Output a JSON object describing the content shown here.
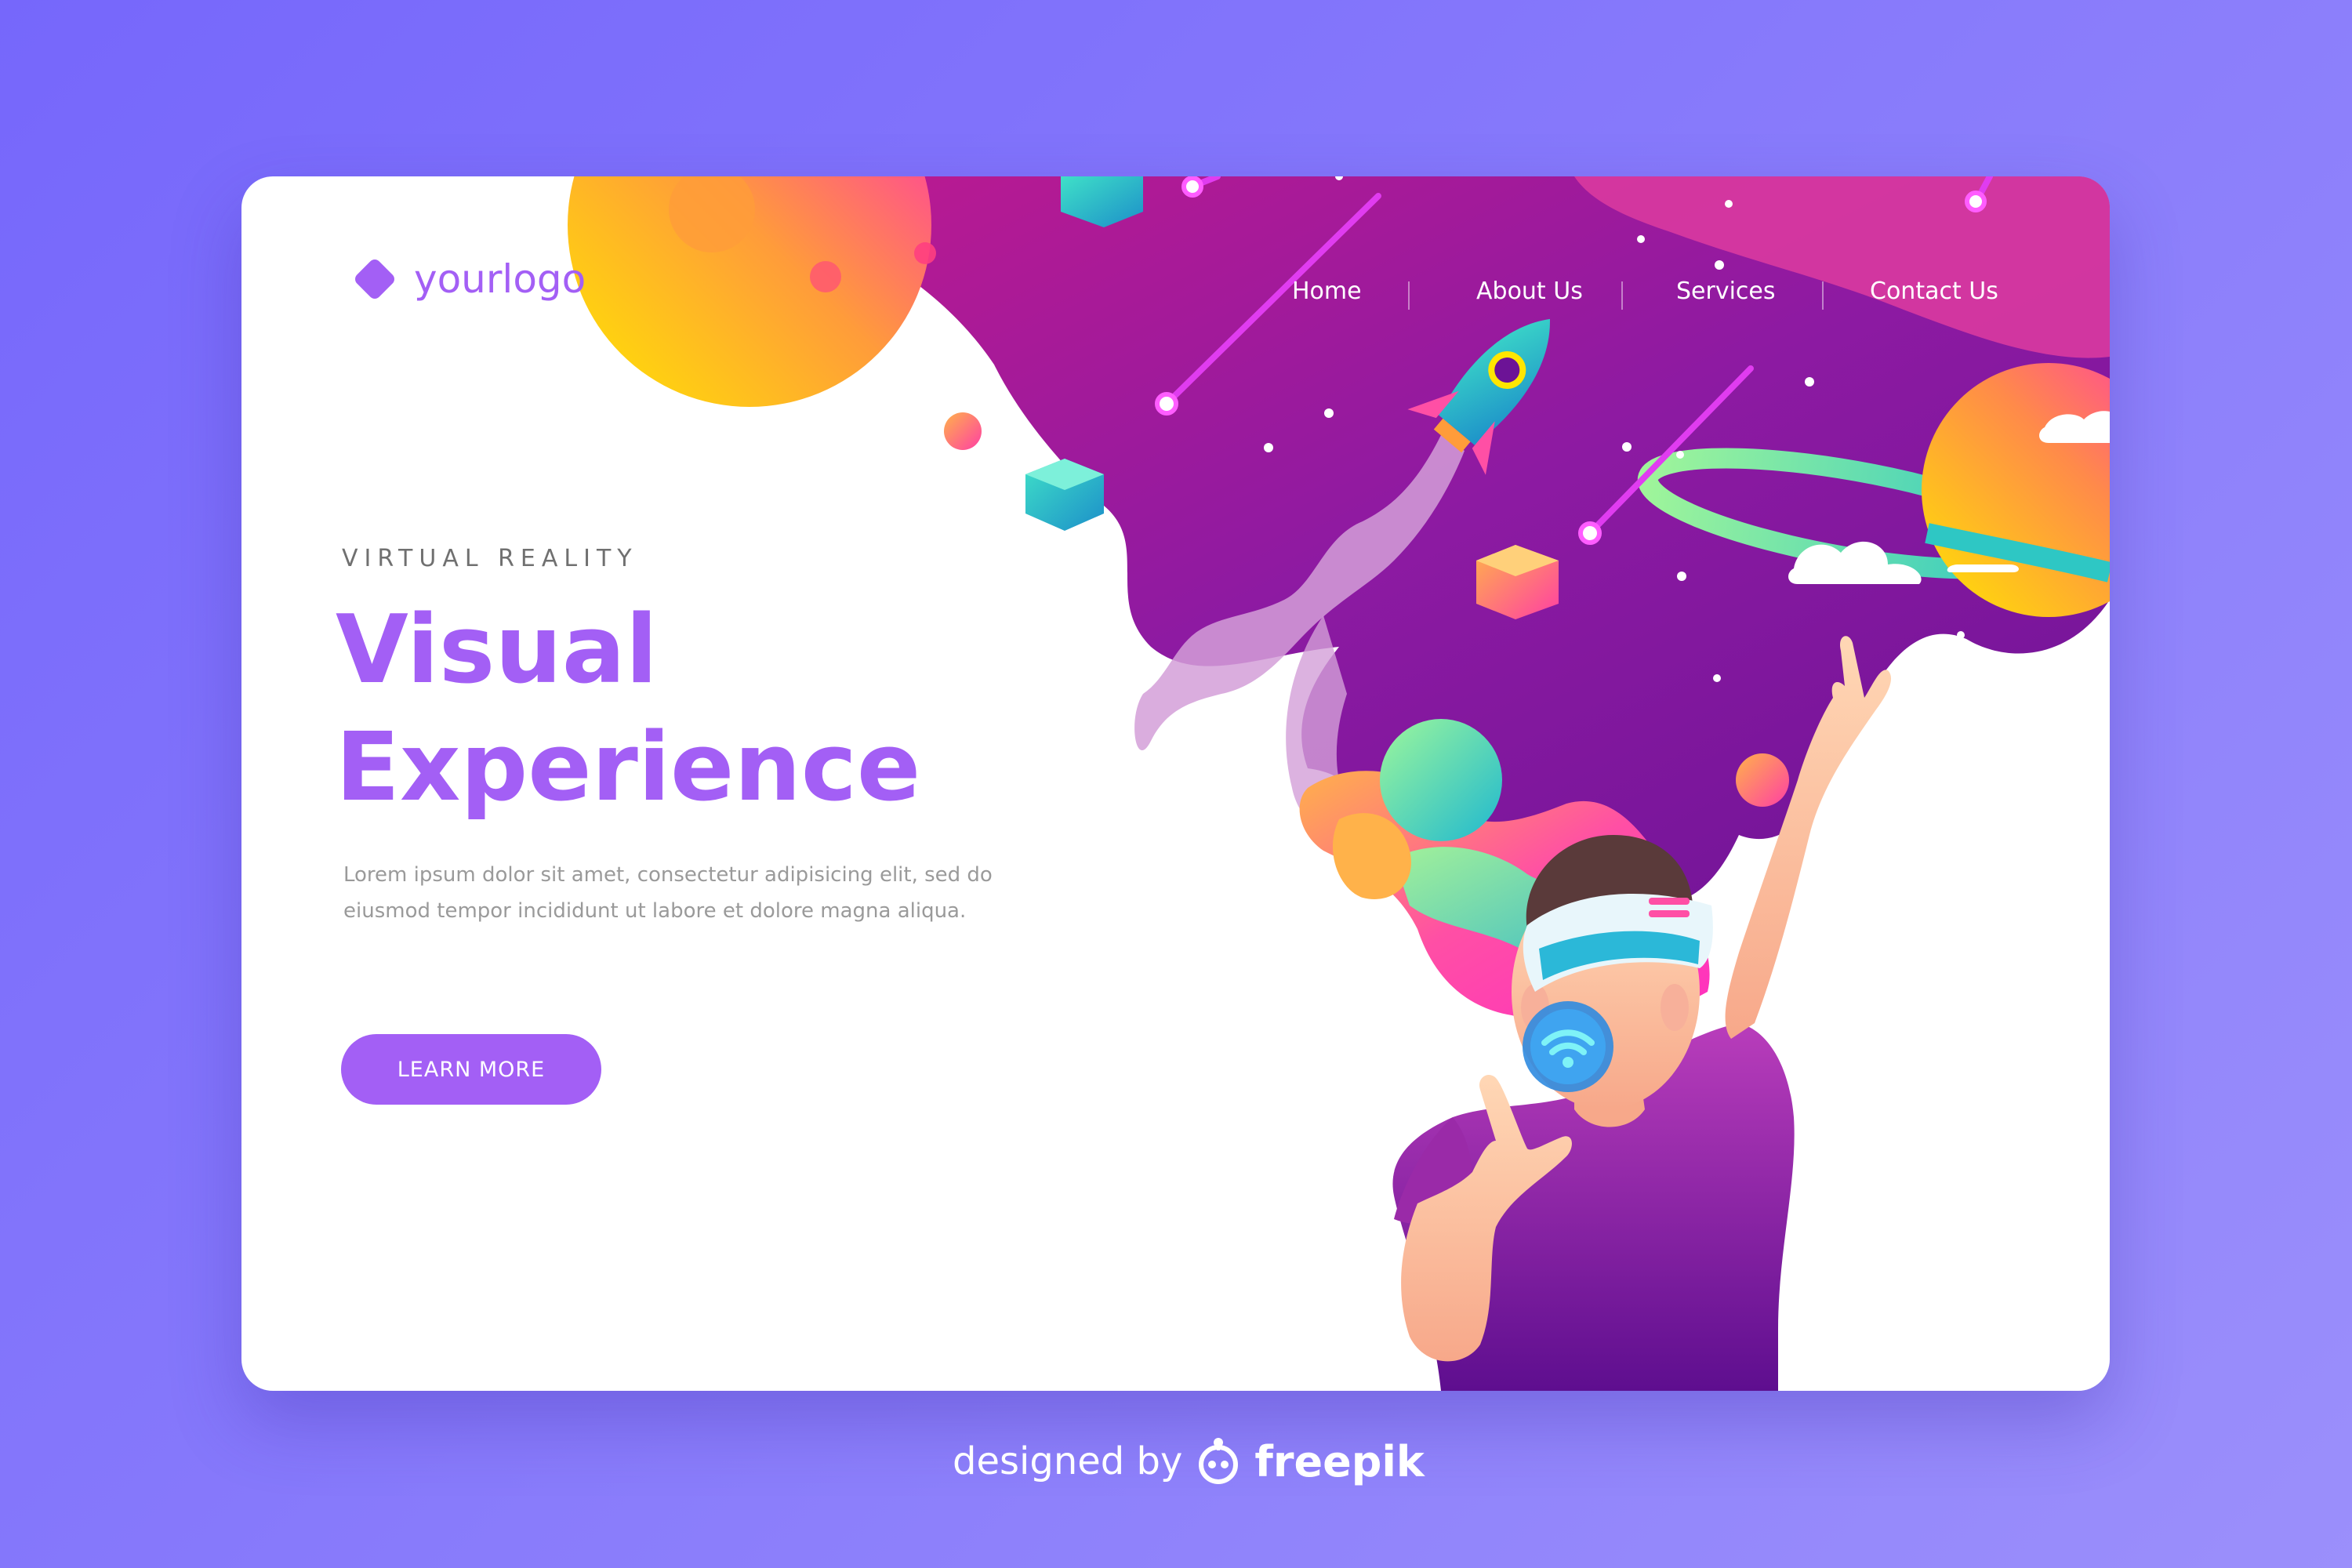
{
  "logo": {
    "text": "yourlogo",
    "icon": "diamond-logo-icon"
  },
  "nav": {
    "items": [
      {
        "label": "Home"
      },
      {
        "label": "About Us"
      },
      {
        "label": "Services"
      },
      {
        "label": "Contact Us"
      }
    ]
  },
  "hero": {
    "eyebrow": "VIRTUAL REALITY",
    "title_line1": "Visual",
    "title_line2": "Experience",
    "body": "Lorem ipsum dolor sit amet, consectetur adipisicing elit, sed do eiusmod tempor incididunt ut labore et dolore magna aliqua.",
    "cta_label": "LEARN MORE"
  },
  "credit": {
    "prefix": "designed by",
    "brand": "freepik",
    "icon": "freepik-mascot-icon"
  },
  "colors": {
    "accent": "#a35ff5",
    "page_background": "#7b6cfb",
    "card": "#ffffff",
    "space": "#8a1aa0",
    "text_muted": "#9a9a9a"
  },
  "illustration": {
    "subject": "person wearing VR headset with space scene",
    "icons": [
      "rocket-icon",
      "ringed-planet-icon",
      "wifi-icon",
      "vr-headset-icon",
      "cube-icon",
      "cloud-icon"
    ]
  }
}
